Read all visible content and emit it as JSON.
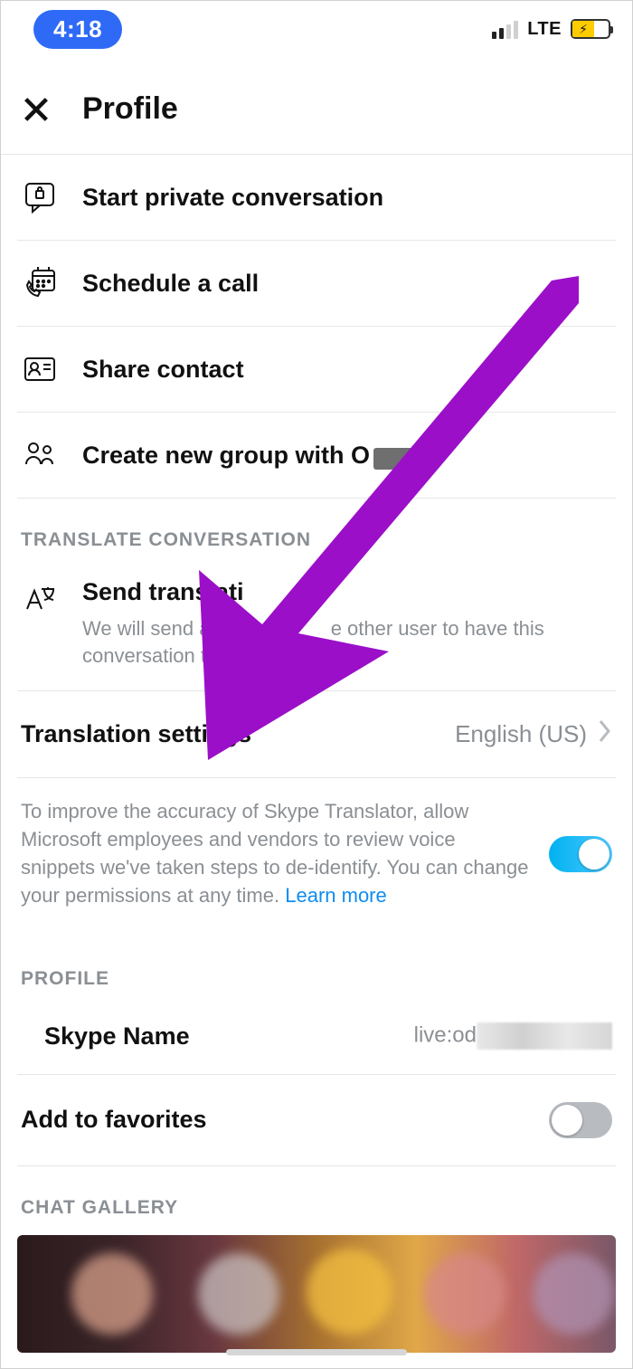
{
  "status_bar": {
    "time": "4:18",
    "network": "LTE"
  },
  "header": {
    "title": "Profile"
  },
  "actions": {
    "private": "Start private conversation",
    "schedule": "Schedule a call",
    "share": "Share contact",
    "group_prefix": "Create new group with O"
  },
  "translate": {
    "section": "TRANSLATE CONVERSATION",
    "send_label": "Send translati",
    "send_desc_a": "We will send an i",
    "send_desc_b": "e other user to have this conversation tra",
    "settings_label": "Translation settings",
    "settings_value": "English (US)",
    "consent_text": "To improve the accuracy of Skype Translator, allow Microsoft employees and vendors to review voice snippets we've taken steps to de-identify. You can change your permissions at any time. ",
    "consent_link": "Learn more",
    "consent_on": true
  },
  "profile": {
    "section": "PROFILE",
    "skype_name_label": "Skype Name",
    "skype_name_value": "live:od",
    "favorites_label": "Add to favorites",
    "favorites_on": false
  },
  "gallery": {
    "section": "CHAT GALLERY"
  }
}
